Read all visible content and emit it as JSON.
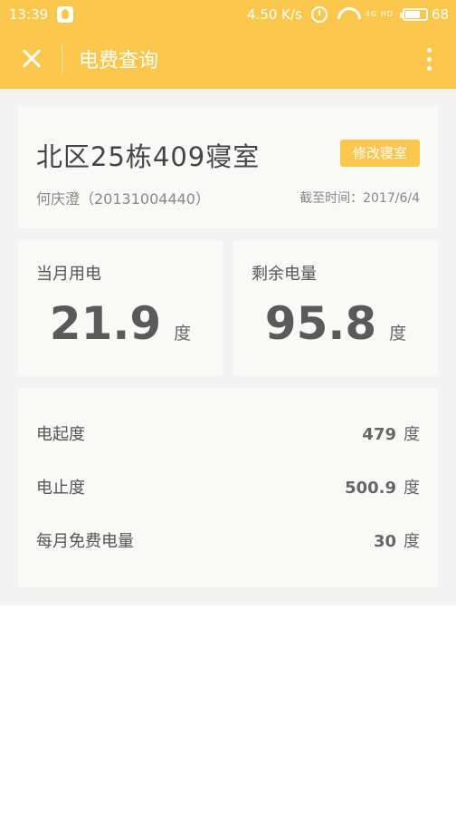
{
  "status_bar": {
    "time": "13:39",
    "network_speed": "4.50 K/s",
    "signal_text": "4G HD",
    "battery": "68",
    "battery_level": 0.68
  },
  "app_bar": {
    "title": "电费查询",
    "close_icon": "close-icon",
    "more_icon": "more-vertical-icon",
    "background_color": "#fcc74d"
  },
  "room": {
    "name": "北区25栋409寝室",
    "edit_label": "修改寝室",
    "user": "何庆澄（20131004440）",
    "date_label": "截至时间：2017/6/4"
  },
  "usage": {
    "label": "当月用电",
    "value": "21.9",
    "unit": "度"
  },
  "remaining": {
    "label": "剩余电量",
    "value": "95.8",
    "unit": "度"
  },
  "details": [
    {
      "label": "电起度",
      "value": "479",
      "unit": "度"
    },
    {
      "label": "电止度",
      "value": "500.9",
      "unit": "度"
    },
    {
      "label": "每月免费电量",
      "value": "30",
      "unit": "度"
    }
  ]
}
